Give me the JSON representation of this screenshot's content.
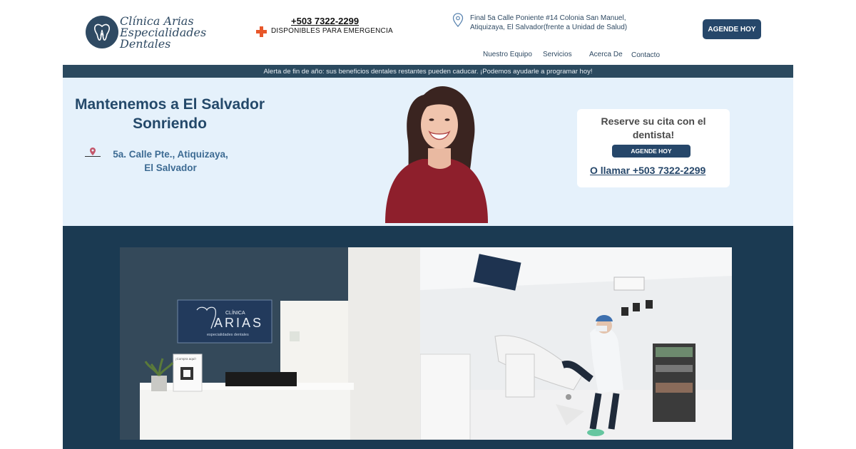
{
  "header": {
    "logo": {
      "line1": "Clínica Arias",
      "line2": "Especialidades",
      "line3": "Dentales"
    },
    "emergency": {
      "phone": "+503 7322-2299",
      "label": "DISPONIBLES PARA EMERGENCIA"
    },
    "address": {
      "line1": "Final 5a Calle Poniente #14 Colonia San Manuel,",
      "line2": "Atiquizaya, El Salvador(frente a Unidad de Salud)"
    },
    "cta": "AGENDE HOY",
    "nav": [
      "Nuestro Equipo",
      "Servicios",
      "Acerca De",
      "Contacto"
    ]
  },
  "alert": "Alerta de fin de año: sus beneficios dentales restantes pueden caducar. ¡Podemos ayudarle a programar hoy!",
  "hero": {
    "title_line1": "Mantenemos a El Salvador",
    "title_line2": "Sonriendo",
    "location_line1": "5a. Calle Pte., Atiquizaya,",
    "location_line2": "El Salvador"
  },
  "booking": {
    "title_line1": "Reserve su cita con el",
    "title_line2": "dentista!",
    "button": "AGENDE HOY",
    "call_prefix": "O  llamar",
    "call_phone": "+503 7322-2299"
  },
  "gallery": {
    "sign": {
      "small": "CLÍNICA",
      "big": "ARIAS",
      "sub": "especialidades dentales"
    },
    "qr_card": "¡Compra aquí!"
  },
  "colors": {
    "primary": "#26476a",
    "alert_bg": "#2b4a5f",
    "hero_bg": "#e5f1fb",
    "gallery_bg": "#1b3a52",
    "emergency_red": "#e8572a"
  }
}
